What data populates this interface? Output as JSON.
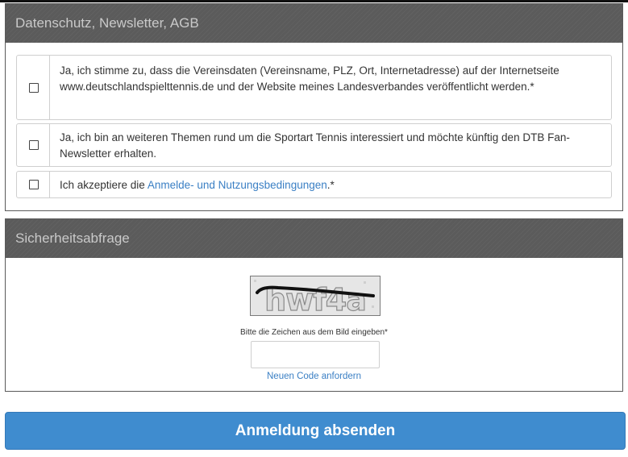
{
  "consent_section": {
    "title": "Datenschutz, Newsletter, AGB",
    "items": [
      {
        "text": "Ja, ich stimme zu, dass die Vereinsdaten (Vereinsname, PLZ, Ort, Internetadresse) auf der Internetseite www.deutschlandspielttennis.de und der Website meines Landesverbandes veröffentlicht werden.*",
        "checked": false
      },
      {
        "text": "Ja, ich bin an weiteren Themen rund um die Sportart Tennis interessiert und möchte künftig den DTB Fan-Newsletter erhalten.",
        "checked": false
      },
      {
        "text_before": "Ich akzeptiere die ",
        "link_text": "Anmelde- und Nutzungsbedingungen",
        "text_after": ".*",
        "checked": false
      }
    ]
  },
  "captcha_section": {
    "title": "Sicherheitsabfrage",
    "captcha_image_text": "hwf4a",
    "prompt": "Bitte die Zeichen aus dem Bild eingeben*",
    "input_value": "",
    "new_code_link": "Neuen Code anfordern"
  },
  "submit": {
    "label": "Anmeldung absenden"
  },
  "colors": {
    "header_bg": "#5b5b5b",
    "header_text": "#c9c9c9",
    "link": "#3a7fc4",
    "button_bg": "#3f8ccf",
    "button_text": "#ffffff"
  },
  "icons": {
    "checkbox": "checkbox-empty"
  }
}
